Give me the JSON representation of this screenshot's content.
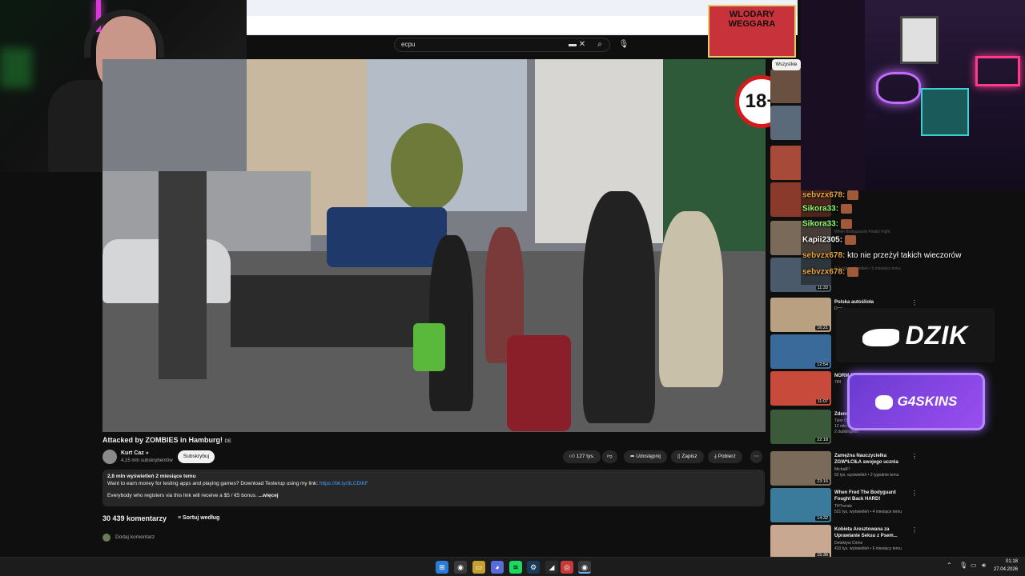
{
  "search": {
    "query": "ecpu"
  },
  "overlays": {
    "age_badge": "18+",
    "wlodary_label": "WLODARY WEGGARA"
  },
  "video": {
    "title": "Attacked by ZOMBIES in Hamburg!",
    "title_suffix": "DE",
    "channel": "Kurt Caz",
    "subscribers": "4,15 mln subskrybentów",
    "subscribe_label": "Subskrybuj",
    "likes": "127 tys.",
    "share_label": "Udostępnij",
    "save_label": "Zapisz",
    "download_label": "Pobierz",
    "more_icon": "more-horiz-icon"
  },
  "description": {
    "stats": "2,8 mln wyświetleń  2 miesiące temu",
    "line1_text": "Want to earn money for testing apps and playing games? Download Testerup using my link: ",
    "line1_link": "https://bit.ly/3LCDlKF",
    "line2": "Everybody who registers via this link will receive a $5 / €5 bonus. ",
    "more": "...więcej"
  },
  "comments": {
    "count": "30 439 komentarzy",
    "sort_label": "Sortuj według",
    "add_placeholder": "Dodaj komentarz"
  },
  "sidebar": {
    "chip_all": "Wszystkie",
    "items": [
      {
        "title": "",
        "meta1": "",
        "meta2": "",
        "duration": "",
        "color": "#6a5040"
      },
      {
        "title": "",
        "meta1": "",
        "meta2": "",
        "duration": "",
        "color": "#5a6a7a"
      },
      {
        "title": "",
        "meta1": "",
        "meta2": "",
        "duration": "",
        "color": "#a84a3a"
      },
      {
        "title": "",
        "meta1": "",
        "meta2": "",
        "duration": "",
        "color": "#8a3a2a"
      },
      {
        "title": "",
        "meta1": "When Bodyguards Finally Fight",
        "meta2": "",
        "duration": "",
        "color": "#7a6a5a"
      },
      {
        "title": "",
        "meta1": "2,3 mln wyświetleń • 5 miesięcy temu",
        "meta2": "",
        "duration": "11:33",
        "color": "#4a5a6a"
      },
      {
        "title": "Polska autoślioła",
        "meta1": "Dorc",
        "meta2": "",
        "duration": "16:21",
        "color": "#b8a080"
      },
      {
        "title": "",
        "meta1": "",
        "meta2": "",
        "duration": "12:54",
        "color": "#3a6a9a"
      },
      {
        "title": "NORM ROZM",
        "meta1": "784",
        "meta2": "",
        "duration": "11:07",
        "color": "#c84a3a"
      },
      {
        "title": "Zdem Rzym",
        "meta1": "Tyler Oliveira",
        "meta2": "12 mln wyświetleń • 8 miesięcy temu",
        "extra": "2 dubbingiem",
        "duration": "22:18",
        "color": "#3a5a3a"
      },
      {
        "title": "Zamężna Nauczycielka ZGW*ŁCIŁA swojego ucznia",
        "meta1": "MichałF!",
        "meta2": "52 tys. wyświetleń • 2 tygodnie temu",
        "duration": "23:16",
        "color": "#7a6a5a"
      },
      {
        "title": "When Fred The Bodyguard Fought Back HARD!",
        "meta1": "THTrendz",
        "meta2": "521 tys. wyświetleń • 4 miesiące temu",
        "duration": "14:32",
        "color": "#3a7a9a"
      },
      {
        "title": "Kobieta Aresztowana za Uprawianie Seksu z Psem...",
        "meta1": "Detektyw Crime",
        "meta2": "410 tys. wyświetleń • 6 miesięcy temu",
        "duration": "15:36",
        "color": "#c8a890"
      }
    ]
  },
  "chat": {
    "messages": [
      {
        "user": "sebvzx678:",
        "text": "",
        "user_color": "#e8a33a"
      },
      {
        "user": "Sikora33:",
        "text": "",
        "user_color": "#8aff6a"
      },
      {
        "user": "Sikora33:",
        "text": "",
        "user_color": "#8aff6a"
      },
      {
        "user": "Kapii2305:",
        "text": "",
        "user_color": "#ffffff"
      },
      {
        "user": "sebvzx678:",
        "text": "kto nie przeżył takich wieczorów",
        "user_color": "#e8a33a"
      },
      {
        "user": "sebvzx678:",
        "text": "",
        "user_color": "#e8a33a"
      }
    ]
  },
  "sponsors": {
    "dzik": "DZIK",
    "g4skins": "G4SKINS"
  },
  "taskbar": {
    "time": "01:18",
    "date": "27.04.2026"
  }
}
